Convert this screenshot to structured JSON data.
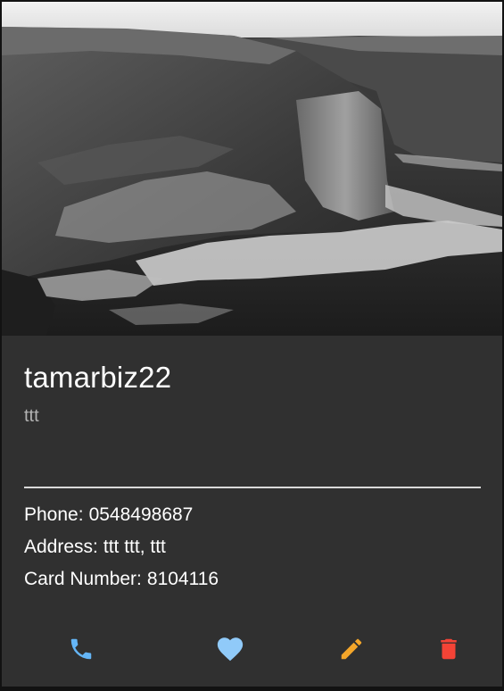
{
  "card": {
    "title": "tamarbiz22",
    "subtitle": "ttt",
    "phone_label": "Phone:",
    "phone_value": "0548498687",
    "address_label": "Address:",
    "address_value": "ttt ttt, ttt",
    "card_number_label": "Card Number:",
    "card_number_value": "8104116",
    "image": {
      "description": "grayscale coastal cliff over sea waves"
    }
  },
  "actions": {
    "icons": [
      "phone-icon",
      "heart-icon",
      "pencil-icon",
      "trash-icon"
    ],
    "colors": {
      "phone": "#64b5f6",
      "favorite": "#90caf9",
      "edit": "#f4a62a",
      "delete": "#f44336"
    }
  },
  "theme": {
    "card_bg": "#303030",
    "page_bg": "#121212",
    "text": "#ffffff",
    "subtext": "#b3b3b3"
  }
}
